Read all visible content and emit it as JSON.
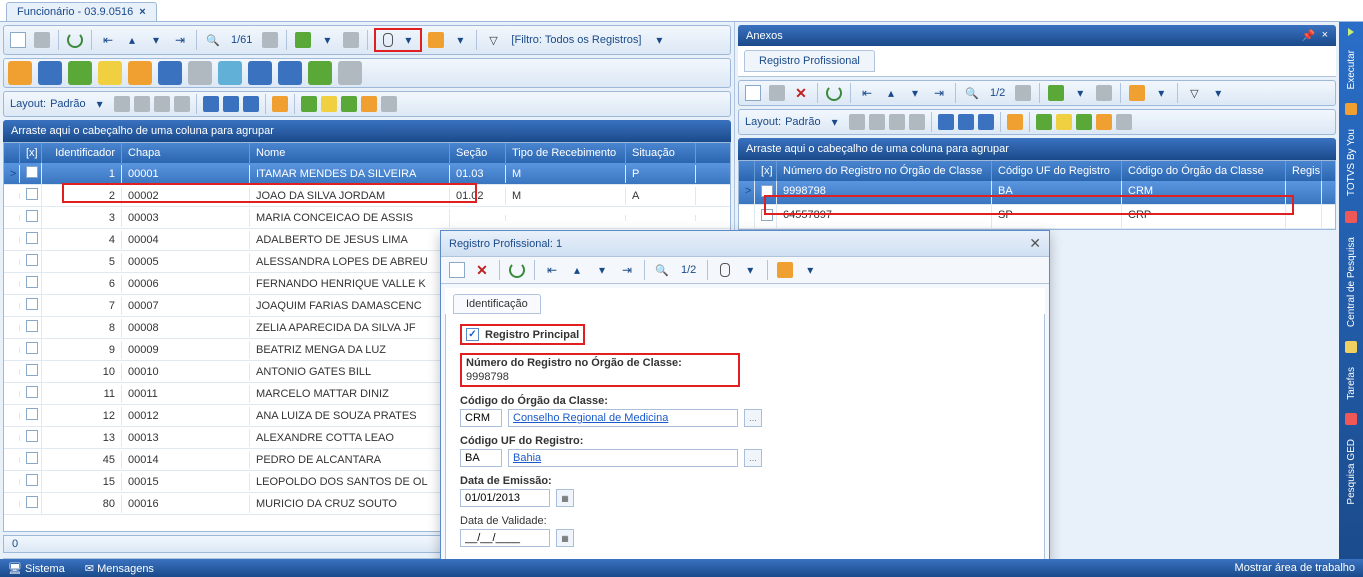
{
  "tab": {
    "title": "Funcionário - 03.9.0516"
  },
  "toolbar": {
    "nav_text": "1/61",
    "filter_text": "[Filtro: Todos os Registros]"
  },
  "layout": {
    "label": "Layout:",
    "value": "Padrão"
  },
  "group_text": "Arraste aqui o cabeçalho de uma coluna para agrupar",
  "grid": {
    "cols": [
      "[x]",
      "Identificador",
      "Chapa",
      "Nome",
      "Seção",
      "Tipo de Recebimento",
      "Situação"
    ],
    "rows": [
      {
        "id": "1",
        "chapa": "00001",
        "nome": "ITAMAR MENDES DA SILVEIRA",
        "secao": "01.03",
        "tipo": "M",
        "sit": "P"
      },
      {
        "id": "2",
        "chapa": "00002",
        "nome": "JOAO DA SILVA JORDAM",
        "secao": "01.02",
        "tipo": "M",
        "sit": "A"
      },
      {
        "id": "3",
        "chapa": "00003",
        "nome": "MARIA CONCEICAO DE ASSIS",
        "secao": "",
        "tipo": "",
        "sit": ""
      },
      {
        "id": "4",
        "chapa": "00004",
        "nome": "ADALBERTO DE JESUS LIMA",
        "secao": "",
        "tipo": "",
        "sit": ""
      },
      {
        "id": "5",
        "chapa": "00005",
        "nome": "ALESSANDRA LOPES DE ABREU",
        "secao": "",
        "tipo": "",
        "sit": ""
      },
      {
        "id": "6",
        "chapa": "00006",
        "nome": "FERNANDO HENRIQUE VALLE K",
        "secao": "",
        "tipo": "",
        "sit": ""
      },
      {
        "id": "7",
        "chapa": "00007",
        "nome": "JOAQUIM FARIAS DAMASCENC",
        "secao": "",
        "tipo": "",
        "sit": ""
      },
      {
        "id": "8",
        "chapa": "00008",
        "nome": "ZELIA APARECIDA DA SILVA JF",
        "secao": "",
        "tipo": "",
        "sit": ""
      },
      {
        "id": "9",
        "chapa": "00009",
        "nome": "BEATRIZ MENGA DA LUZ",
        "secao": "",
        "tipo": "",
        "sit": ""
      },
      {
        "id": "10",
        "chapa": "00010",
        "nome": "ANTONIO GATES BILL",
        "secao": "",
        "tipo": "",
        "sit": ""
      },
      {
        "id": "11",
        "chapa": "00011",
        "nome": "MARCELO MATTAR DINIZ",
        "secao": "",
        "tipo": "",
        "sit": ""
      },
      {
        "id": "12",
        "chapa": "00012",
        "nome": "ANA LUIZA  DE SOUZA PRATES",
        "secao": "",
        "tipo": "",
        "sit": ""
      },
      {
        "id": "13",
        "chapa": "00013",
        "nome": "ALEXANDRE COTTA LEAO",
        "secao": "",
        "tipo": "",
        "sit": ""
      },
      {
        "id": "45",
        "chapa": "00014",
        "nome": "PEDRO DE ALCANTARA",
        "secao": "",
        "tipo": "",
        "sit": ""
      },
      {
        "id": "15",
        "chapa": "00015",
        "nome": "LEOPOLDO DOS SANTOS DE OL",
        "secao": "",
        "tipo": "",
        "sit": ""
      },
      {
        "id": "80",
        "chapa": "00016",
        "nome": "MURICIO DA CRUZ SOUTO",
        "secao": "",
        "tipo": "",
        "sit": ""
      }
    ],
    "page_indicator": "0"
  },
  "anexos": {
    "title": "Anexos",
    "tab": "Registro Profissional",
    "nav_text": "1/2",
    "cols": [
      "[x]",
      "Número do Registro no Órgão de Classe",
      "Código UF do Registro",
      "Código do Órgão da Classe",
      "Regis"
    ],
    "rows": [
      {
        "num": "9998798",
        "uf": "BA",
        "orgao": "CRM"
      },
      {
        "num": "64557897",
        "uf": "SP",
        "orgao": "CRP"
      }
    ]
  },
  "dialog": {
    "title": "Registro Profissional: 1",
    "nav_text": "1/2",
    "tab": "Identificação",
    "registro_principal_label": "Registro Principal",
    "num_label": "Número do Registro no Órgão de Classe:",
    "num_value": "9998798",
    "orgao_label": "Código do Órgão da Classe:",
    "orgao_code": "CRM",
    "orgao_desc": "Conselho Regional de Medicina",
    "uf_label": "Código UF do Registro:",
    "uf_code": "BA",
    "uf_desc": "Bahia",
    "emissao_label": "Data de Emissão:",
    "emissao_value": "01/01/2013",
    "validade_label": "Data de Validade:",
    "validade_value": "__/__/____"
  },
  "side": {
    "executar": "Executar",
    "byyou": "TOTVS By You",
    "central": "Central de Pesquisa",
    "tarefas": "Tarefas",
    "ged": "Pesquisa GED"
  },
  "status": {
    "sistema": "Sistema",
    "mensagens": "Mensagens",
    "mostrar": "Mostrar área de trabalho"
  }
}
